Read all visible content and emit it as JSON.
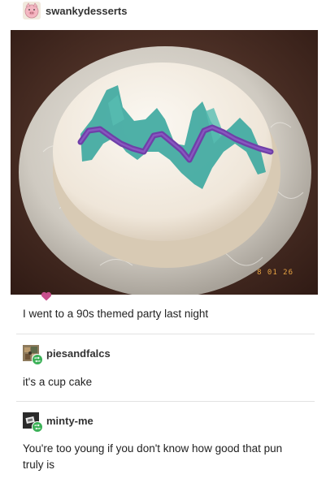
{
  "original_post": {
    "username": "swankydesserts",
    "avatar_icon": "pig-face-icon",
    "photo_timestamp": "8 01 26",
    "caption": "I went to a 90s themed party last night",
    "heart_color": "#c84f8d"
  },
  "reblogs": [
    {
      "username": "piesandfalcs",
      "avatar_icon": "artwork-avatar-icon",
      "text": "it's a cup cake"
    },
    {
      "username": "minty-me",
      "avatar_icon": "dark-avatar-icon",
      "text": "You're too young if you don't know how good that pun truly is"
    }
  ],
  "colors": {
    "reblog_badge": "#3bb157",
    "cake_frosting": "#f3ece3",
    "teal_icing": "#3fa9a1",
    "purple_icing": "#6f3fa8"
  }
}
